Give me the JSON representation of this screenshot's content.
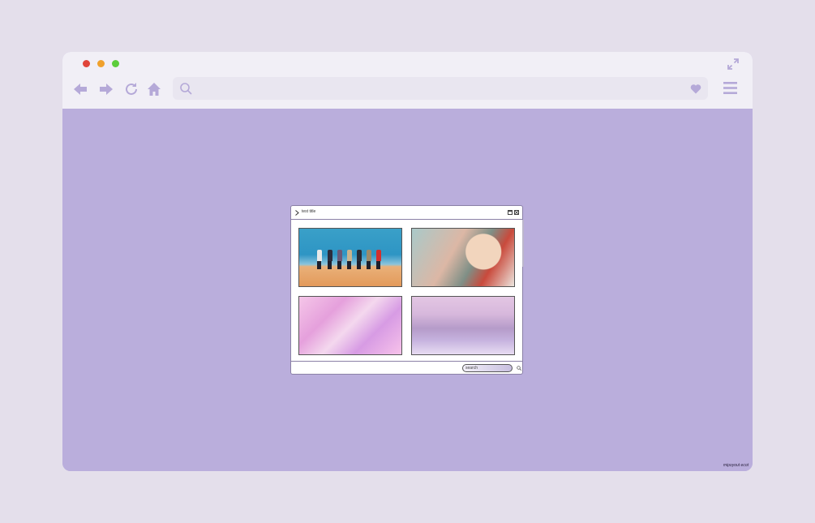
{
  "colors": {
    "page_bg": "#e4dfeb",
    "chrome_bg": "#f1eff6",
    "content_bg": "#baaedc",
    "icon_color": "#b5a9d8"
  },
  "browser": {
    "icons": [
      "back-arrow-icon",
      "forward-arrow-icon",
      "reload-icon",
      "home-icon",
      "search-icon",
      "heart-icon",
      "hamburger-menu-icon",
      "expand-icon"
    ],
    "watermark": "mipoyout ecot"
  },
  "window": {
    "title": "test title",
    "search_placeholder": "search",
    "images": [
      "group-photo",
      "hand-with-flowers",
      "pink-hands",
      "clouds-aerial"
    ]
  }
}
